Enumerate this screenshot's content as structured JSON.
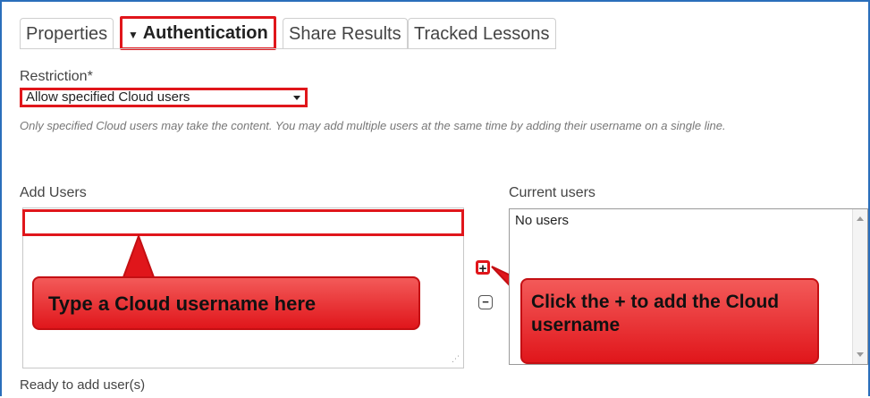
{
  "tabs": [
    {
      "label": "Properties",
      "active": false
    },
    {
      "label": "Authentication",
      "active": true
    },
    {
      "label": "Share Results",
      "active": false
    },
    {
      "label": "Tracked Lessons",
      "active": false
    }
  ],
  "restriction": {
    "label": "Restriction*",
    "selected": "Allow specified Cloud users",
    "help_text": "Only specified Cloud users may take the content. You may add multiple users at the same time by adding their username on a single line."
  },
  "add_users": {
    "label": "Add Users",
    "status": "Ready to add user(s)"
  },
  "current_users": {
    "label": "Current users",
    "items": [
      "No users"
    ]
  },
  "buttons": {
    "add": "+",
    "remove": "−"
  },
  "callouts": {
    "username": "Type a Cloud username here",
    "add": "Click the + to add the Cloud username"
  },
  "colors": {
    "highlight": "#e0161b",
    "frame": "#2a6ebb"
  },
  "icons": {
    "tab_active_marker": "caret-down-icon",
    "select_caret": "chevron-down-icon"
  }
}
